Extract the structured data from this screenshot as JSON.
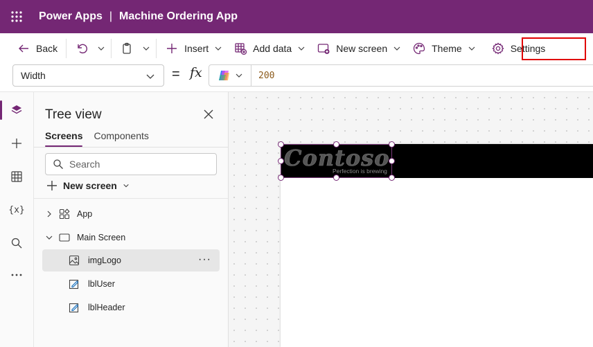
{
  "app": {
    "product": "Power Apps",
    "separator": "|",
    "name": "Machine Ordering App"
  },
  "toolbar": {
    "back": "Back",
    "insert": "Insert",
    "add_data": "Add data",
    "new_screen": "New screen",
    "theme": "Theme",
    "settings": "Settings"
  },
  "formula": {
    "property": "Width",
    "equals": "=",
    "fx": "fx",
    "value": "200"
  },
  "rail": {
    "variables_label": "{x}"
  },
  "tree": {
    "title": "Tree view",
    "tabs": [
      "Screens",
      "Components"
    ],
    "search_placeholder": "Search",
    "new_screen": "New screen",
    "nodes": [
      {
        "label": "App",
        "icon": "app-icon",
        "expander": "collapsed"
      },
      {
        "label": "Main Screen",
        "icon": "screen-icon",
        "expander": "expanded"
      },
      {
        "label": "imgLogo",
        "icon": "image-icon",
        "selected": true,
        "more": "···"
      },
      {
        "label": "lblUser",
        "icon": "label-icon"
      },
      {
        "label": "lblHeader",
        "icon": "label-icon"
      }
    ]
  },
  "canvas": {
    "logo_text": "Contoso",
    "logo_tagline": "Perfection is brewing"
  },
  "colors": {
    "brand": "#742774",
    "highlight": "#e00000",
    "formula_value": "#8c5a1a"
  }
}
